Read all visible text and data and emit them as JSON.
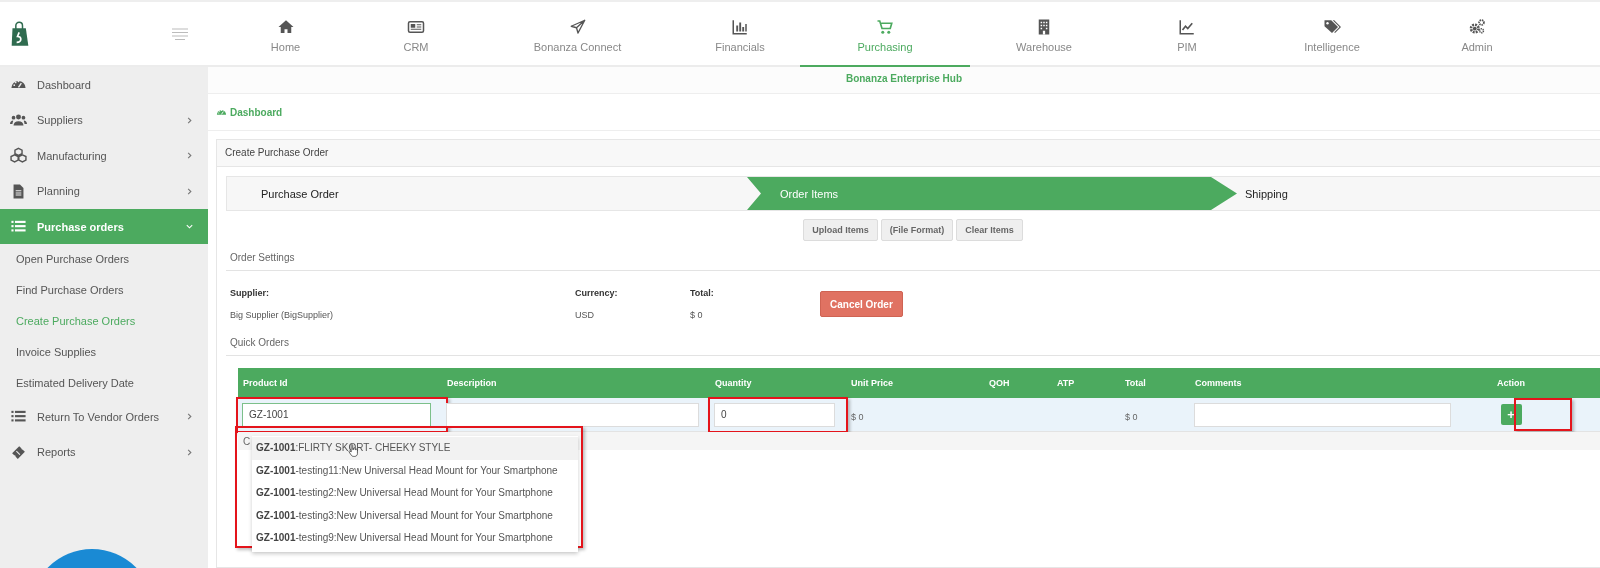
{
  "nav": [
    {
      "label": "Home",
      "selected": false
    },
    {
      "label": "CRM",
      "selected": false
    },
    {
      "label": "Bonanza Connect",
      "selected": false
    },
    {
      "label": "Financials",
      "selected": false
    },
    {
      "label": "Purchasing",
      "selected": true
    },
    {
      "label": "Warehouse",
      "selected": false
    },
    {
      "label": "PIM",
      "selected": false
    },
    {
      "label": "Intelligence",
      "selected": false
    },
    {
      "label": "Admin",
      "selected": false
    }
  ],
  "sidebar": {
    "items": [
      {
        "label": "Dashboard",
        "kind": "link",
        "selected": false
      },
      {
        "label": "Suppliers",
        "kind": "menu",
        "expanded": false,
        "selected": false
      },
      {
        "label": "Manufacturing",
        "kind": "menu",
        "expanded": false,
        "selected": false
      },
      {
        "label": "Planning",
        "kind": "menu",
        "expanded": false,
        "selected": false
      },
      {
        "label": "Purchase orders",
        "kind": "menu",
        "expanded": true,
        "selected": true,
        "children": [
          {
            "label": "Open Purchase Orders",
            "selected": false
          },
          {
            "label": "Find Purchase Orders",
            "selected": false
          },
          {
            "label": "Create Purchase Orders",
            "selected": true
          },
          {
            "label": "Invoice Supplies",
            "selected": false
          },
          {
            "label": "Estimated Delivery Date",
            "selected": false
          }
        ]
      },
      {
        "label": "Return To Vendor Orders",
        "kind": "menu",
        "expanded": false,
        "selected": false
      },
      {
        "label": "Reports",
        "kind": "menu",
        "expanded": false,
        "selected": false
      }
    ]
  },
  "hub_title": "Bonanza Enterprise Hub",
  "breadcrumb": "Dashboard",
  "panel": {
    "title": "Create Purchase Order",
    "steps": [
      {
        "label": "Purchase Order",
        "selected": false
      },
      {
        "label": "Order Items",
        "selected": true
      },
      {
        "label": "Shipping",
        "selected": false
      }
    ],
    "file_buttons": [
      "Upload Items",
      "(File Format)",
      "Clear Items"
    ],
    "order_settings": {
      "title": "Order Settings",
      "fields": [
        {
          "label": "Supplier:",
          "value": "Big Supplier (BigSupplier)"
        },
        {
          "label": "Currency:",
          "value": "USD"
        },
        {
          "label": "Total:",
          "value": "$ 0"
        }
      ],
      "cancel_button": "Cancel Order"
    },
    "quick_orders": {
      "title": "Quick Orders",
      "columns": [
        "Product Id",
        "Description",
        "Quantity",
        "Unit Price",
        "QOH",
        "ATP",
        "Total",
        "Comments",
        "Action"
      ],
      "row": [
        {
          "kind": "input",
          "value": "GZ-1001",
          "highlighted": true
        },
        {
          "kind": "input"
        },
        {
          "kind": "input",
          "value": "0",
          "highlighted": true
        },
        {
          "kind": "text",
          "value": "$ 0"
        },
        {
          "kind": "empty"
        },
        {
          "kind": "empty"
        },
        {
          "kind": "text",
          "value": "$ 0"
        },
        {
          "kind": "input"
        },
        {
          "kind": "button",
          "value": "+",
          "highlighted": true
        }
      ],
      "covered_section_title": "C",
      "suggestions": {
        "highlighted": true,
        "items": [
          {
            "text": "**GZ-1001**:FLIRTY SKORT- CHEEKY STYLE",
            "selected": true
          },
          {
            "text": "**GZ-1001**-testing11:New Universal Head Mount for Your Smartphone",
            "selected": false
          },
          {
            "text": "**GZ-1001**-testing2:New Universal Head Mount for Your Smartphone",
            "selected": false
          },
          {
            "text": "**GZ-1001**-testing3:New Universal Head Mount for Your Smartphone",
            "selected": false
          },
          {
            "text": "**GZ-1001**-testing9:New Universal Head Mount for Your Smartphone",
            "selected": false
          }
        ]
      }
    }
  }
}
